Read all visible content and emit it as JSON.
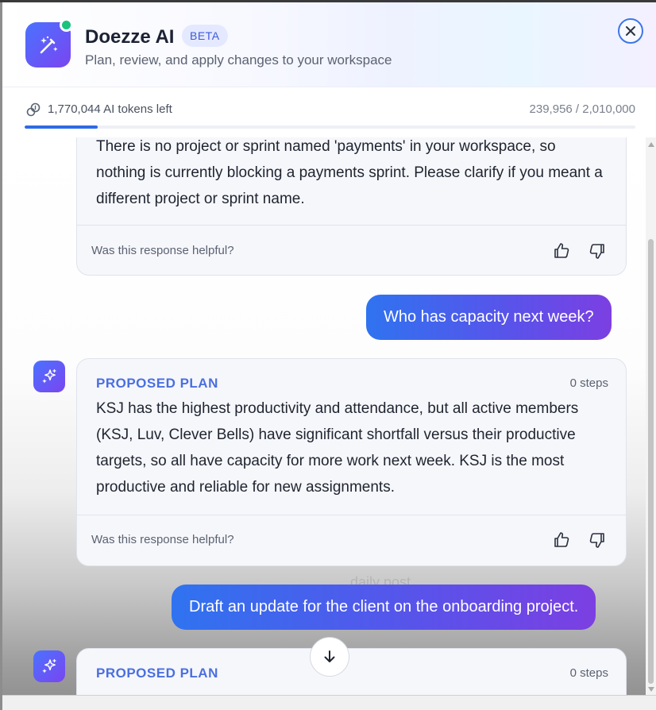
{
  "header": {
    "title": "Doezze AI",
    "badge": "BETA",
    "subtitle": "Plan, review, and apply changes to your workspace",
    "icon": "magic-wand-icon",
    "close_icon": "close-icon"
  },
  "tokens": {
    "left_label": "1,770,044 AI tokens left",
    "usage_label": "239,956 / 2,010,000",
    "used_fraction": 0.119,
    "icon": "link-coin-icon"
  },
  "messages": [
    {
      "role": "assistant",
      "text": "There is no project or sprint named 'payments' in your workspace, so nothing is currently blocking a payments sprint. Please clarify if you meant a different project or sprint name.",
      "helpful_prompt": "Was this response helpful?"
    },
    {
      "role": "user",
      "text": "Who has capacity next week?"
    },
    {
      "role": "assistant",
      "plan_label": "PROPOSED PLAN",
      "steps": "0 steps",
      "text": "KSJ has the highest productivity and attendance, but all active members (KSJ, Luv, Clever Bells) have significant shortfall versus their productive targets, so all have capacity for more work next week. KSJ is the most productive and reliable for new assignments.",
      "helpful_prompt": "Was this response helpful?"
    },
    {
      "role": "user",
      "text": "Draft an update for the client on the onboarding project."
    },
    {
      "role": "assistant",
      "plan_label": "PROPOSED PLAN",
      "steps": "0 steps"
    }
  ],
  "ghost_text": "daily post",
  "icons": {
    "avatar": "sparkle-icon",
    "thumbs_up": "thumbs-up-icon",
    "thumbs_down": "thumbs-down-icon",
    "scroll_down": "arrow-down-icon"
  },
  "colors": {
    "accent": "#2e6be6",
    "plan_label": "#4a6fe0",
    "online": "#19c37d",
    "bubble_start": "#2f73f0",
    "bubble_end": "#7c3fe2"
  }
}
